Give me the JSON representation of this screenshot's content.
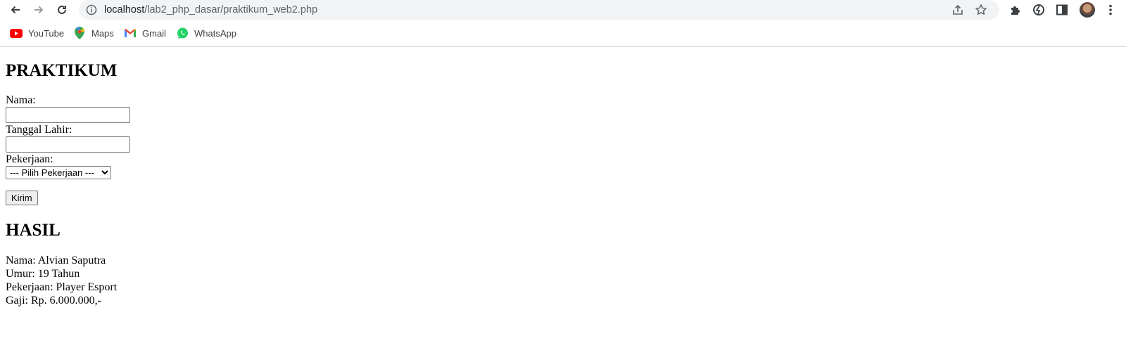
{
  "browser": {
    "url_host": "localhost",
    "url_path": "/lab2_php_dasar/praktikum_web2.php",
    "bookmarks": [
      {
        "label": "YouTube",
        "icon": "youtube-icon"
      },
      {
        "label": "Maps",
        "icon": "maps-icon"
      },
      {
        "label": "Gmail",
        "icon": "gmail-icon"
      },
      {
        "label": "WhatsApp",
        "icon": "whatsapp-icon"
      }
    ]
  },
  "page": {
    "title": "PRAKTIKUM",
    "form": {
      "nama_label": "Nama:",
      "nama_value": "",
      "tanggal_label": "Tanggal Lahir:",
      "tanggal_value": "",
      "pekerjaan_label": "Pekerjaan:",
      "pekerjaan_selected": "--- Pilih Pekerjaan ---",
      "submit_label": "Kirim"
    },
    "result_title": "HASIL",
    "result": {
      "nama": "Nama: Alvian Saputra",
      "umur": "Umur: 19 Tahun",
      "pekerjaan": "Pekerjaan: Player Esport",
      "gaji": "Gaji: Rp. 6.000.000,-"
    }
  }
}
